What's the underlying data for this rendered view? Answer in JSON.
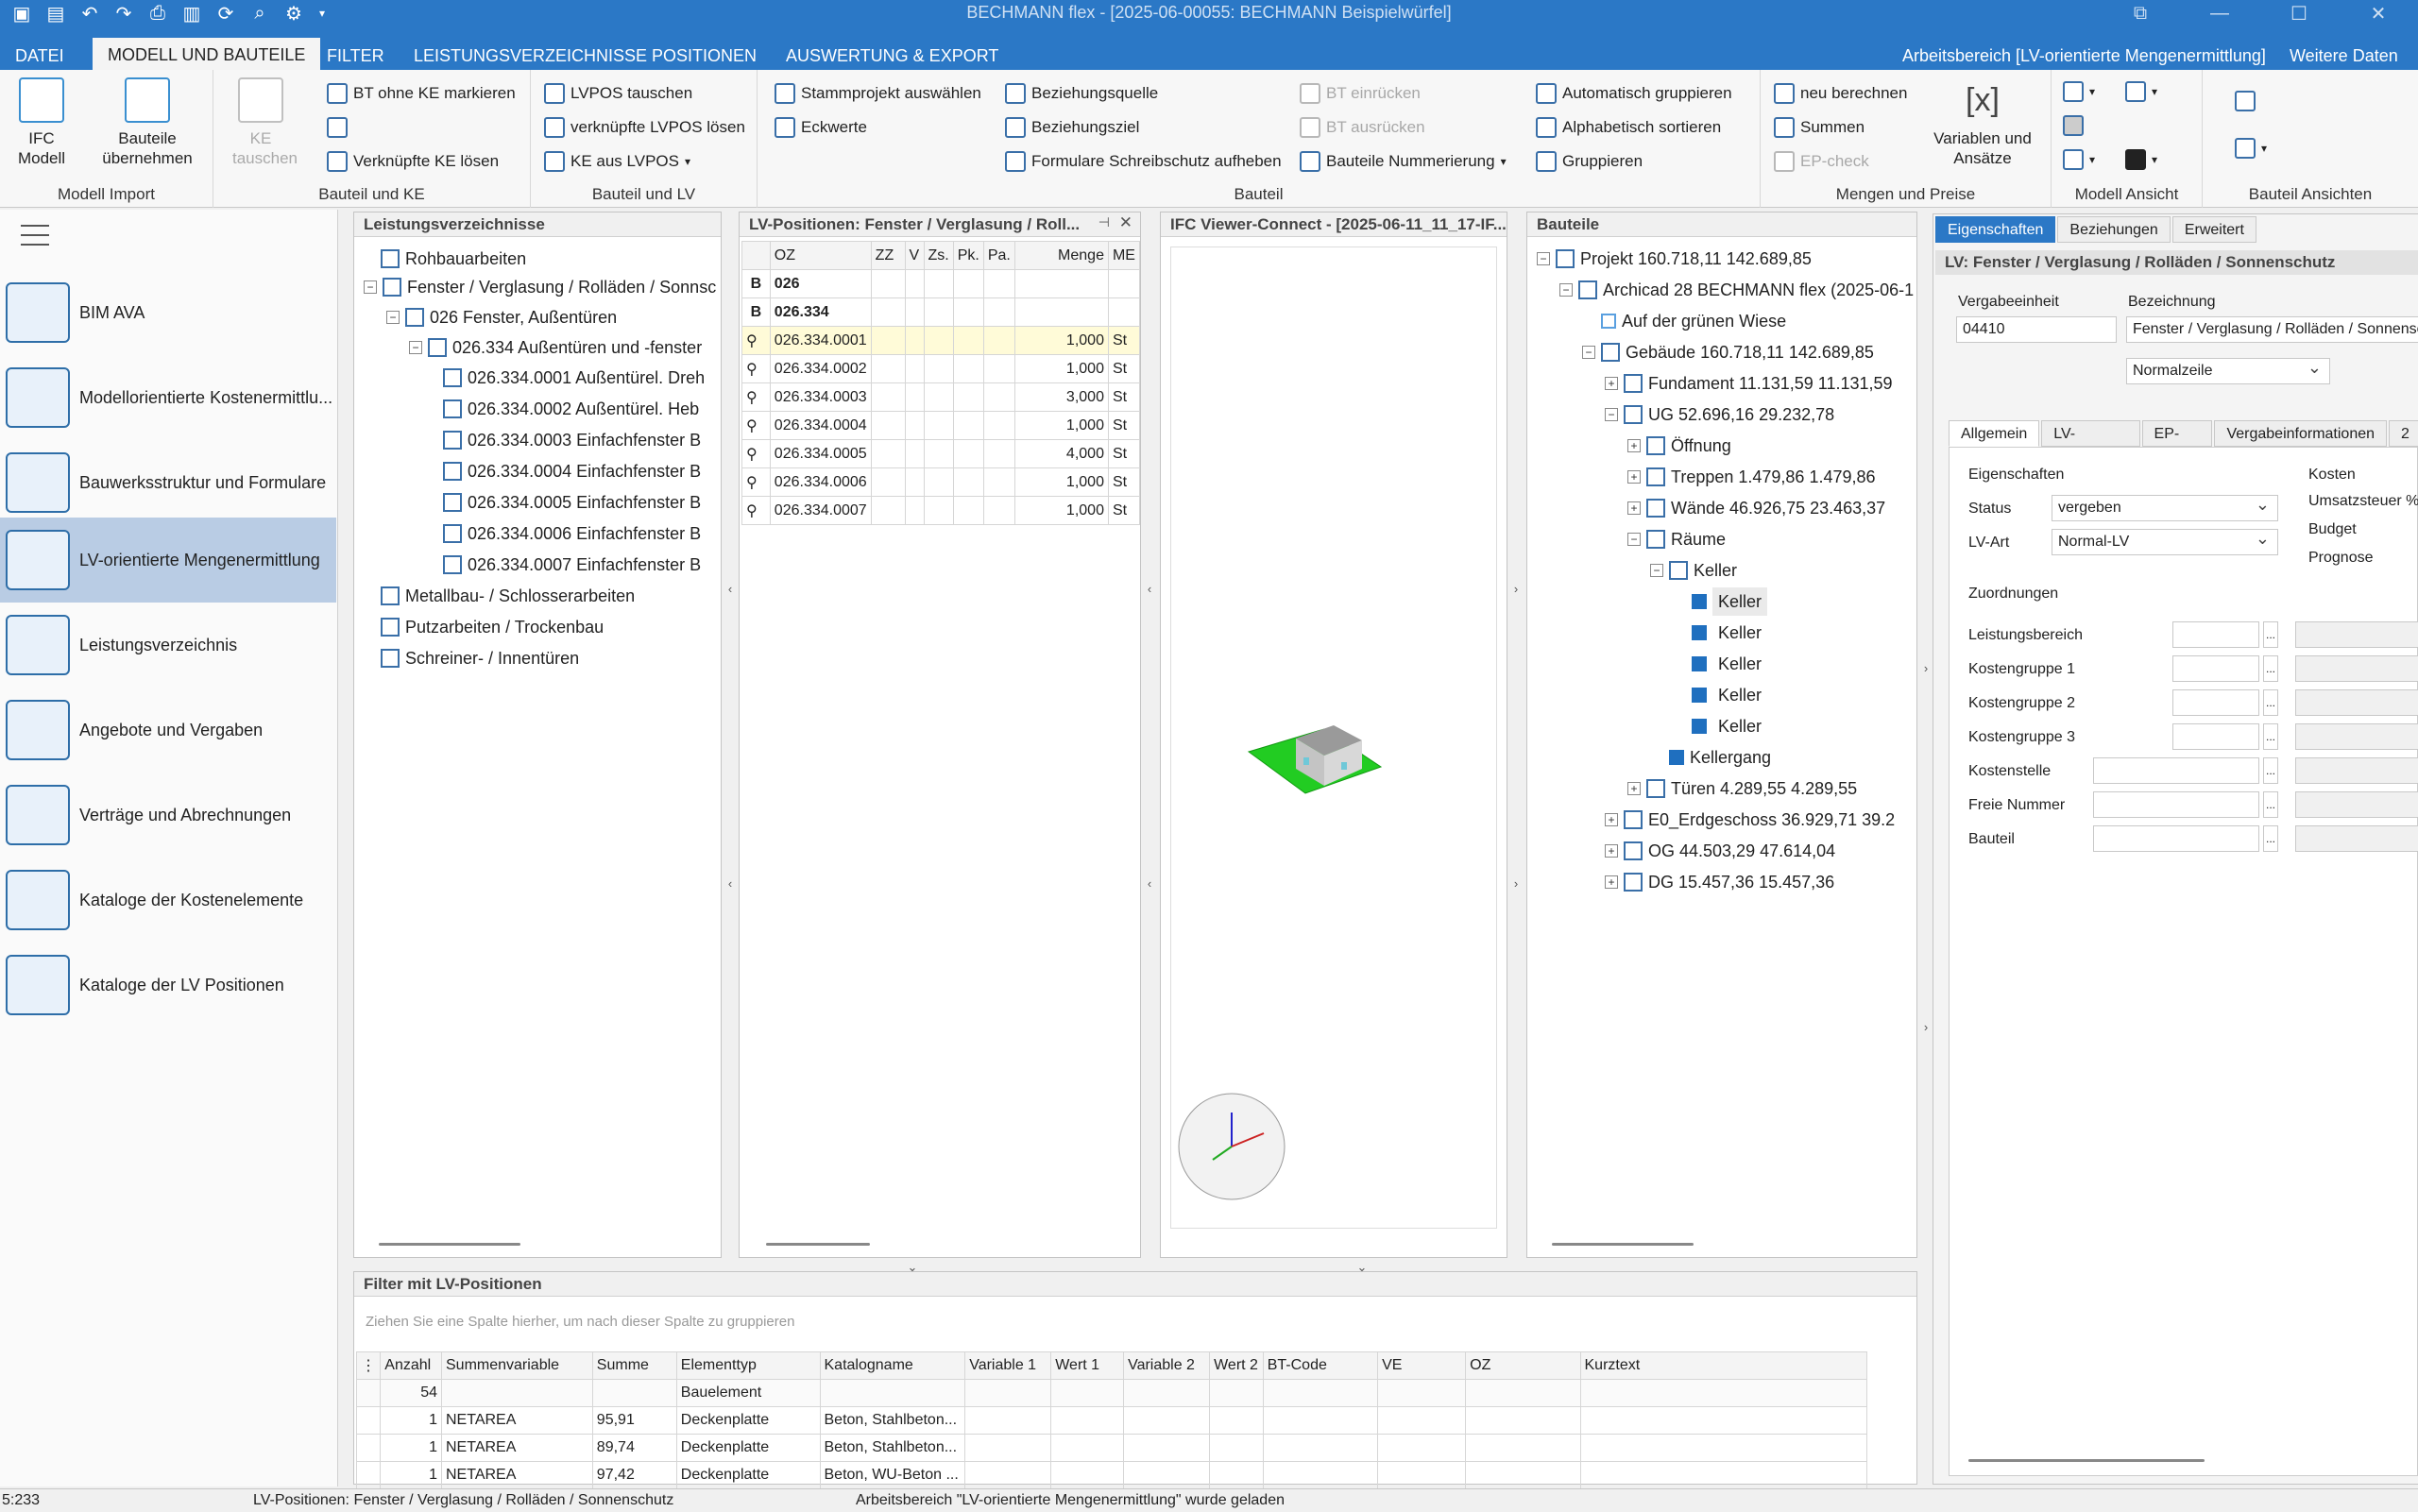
{
  "window": {
    "title": "BECHMANN flex - [2025-06-00055: BECHMANN Beispielwürfel]"
  },
  "menu": {
    "tabs": [
      "DATEI",
      "MODELL UND BAUTEILE",
      "FILTER",
      "LEISTUNGSVERZEICHNISSE",
      "POSITIONEN",
      "AUSWERTUNG & EXPORT"
    ],
    "workspace": "Arbeitsbereich [LV-orientierte Mengenermittlung]",
    "more": "Weitere Daten"
  },
  "ribbon": {
    "g1": {
      "label": "Modell Import",
      "ifc": "IFC\nModell",
      "bauteile": "Bauteile\nübernehmen"
    },
    "g2": {
      "label": "Bauteil und KE",
      "ke_tauschen": "KE\ntauschen",
      "bt_ohne_ke": "BT ohne KE markieren",
      "verknuepfte_ke": "Verknüpfte KE lösen"
    },
    "g3": {
      "label": "Bauteil und LV",
      "lvpos_tauschen": "LVPOS tauschen",
      "verkn_lvpos": "verknüpfte LVPOS lösen",
      "ke_aus_lvpos": "KE aus LVPOS"
    },
    "g4": {
      "label": "Bauteil",
      "stammprojekt": "Stammprojekt auswählen",
      "eckwerte": "Eckwerte",
      "bezquelle": "Beziehungsquelle",
      "bezziel": "Beziehungsziel",
      "formulare": "Formulare Schreibschutz aufheben",
      "bt_einruecken": "BT einrücken",
      "bt_ausruecken": "BT ausrücken",
      "nummerierung": "Bauteile Nummerierung",
      "auto_grupp": "Automatisch gruppieren",
      "alpha": "Alphabetisch sortieren",
      "gruppieren": "Gruppieren"
    },
    "g5": {
      "label": "Mengen und Preise",
      "neu": "neu berechnen",
      "summen": "Summen",
      "epcheck": "EP-check",
      "variablen": "Variablen und\nAnsätze"
    },
    "g6": {
      "label": "Modell Ansicht"
    },
    "g7": {
      "label": "Bauteil Ansichten"
    }
  },
  "nav": {
    "items": [
      "BIM AVA",
      "Modellorientierte Kostenermittlu...",
      "Bauwerksstruktur und Formulare",
      "LV-orientierte Mengenermittlung",
      "Leistungsverzeichnis",
      "Angebote und Vergaben",
      "Verträge und Abrechnungen",
      "Kataloge der Kostenelemente",
      "Kataloge der LV Positionen"
    ]
  },
  "lv": {
    "title": "Leistungsverzeichnisse",
    "rows": [
      "Rohbauarbeiten",
      "Fenster / Verglasung / Rolläden / Sonnsc",
      "026  Fenster, Außentüren",
      "026.334  Außentüren und -fenster",
      "026.334.0001  Außentürel. Dreh",
      "026.334.0002  Außentürel. Heb",
      "026.334.0003  Einfachfenster B",
      "026.334.0004  Einfachfenster B",
      "026.334.0005  Einfachfenster B",
      "026.334.0006  Einfachfenster B",
      "026.334.0007  Einfachfenster B",
      "Metallbau- / Schlosserarbeiten",
      "Putzarbeiten / Trockenbau",
      "Schreiner- / Innentüren"
    ]
  },
  "lvpos": {
    "title": "LV-Positionen: Fenster / Verglasung / Roll...",
    "cols": [
      "OZ",
      "ZZ",
      "V",
      "Zs.",
      "Pk.",
      "Pa.",
      "Menge",
      "ME"
    ],
    "headrows": [
      {
        "t": "B",
        "oz": "026"
      },
      {
        "t": "B",
        "oz": "026.334"
      }
    ],
    "rows": [
      {
        "oz": "026.334.0001",
        "m": "1,000",
        "me": "St"
      },
      {
        "oz": "026.334.0002",
        "m": "1,000",
        "me": "St"
      },
      {
        "oz": "026.334.0003",
        "m": "3,000",
        "me": "St"
      },
      {
        "oz": "026.334.0004",
        "m": "1,000",
        "me": "St"
      },
      {
        "oz": "026.334.0005",
        "m": "4,000",
        "me": "St"
      },
      {
        "oz": "026.334.0006",
        "m": "1,000",
        "me": "St"
      },
      {
        "oz": "026.334.0007",
        "m": "1,000",
        "me": "St"
      }
    ]
  },
  "viewer": {
    "title": "IFC Viewer-Connect - [2025-06-11_11_17-IF..."
  },
  "bauteile": {
    "title": "Bauteile",
    "rows": [
      "Projekt  160.718,11  142.689,85",
      "Archicad 28 BECHMANN flex (2025-06-1",
      "Auf der grünen Wiese",
      "Gebäude  160.718,11  142.689,85",
      "Fundament  11.131,59  11.131,59",
      "UG  52.696,16  29.232,78",
      "Öffnung",
      "Treppen  1.479,86  1.479,86",
      "Wände  46.926,75  23.463,37",
      "Räume",
      "Keller",
      "Keller",
      "Keller",
      "Keller",
      "Keller",
      "Keller",
      "Kellergang",
      "Türen  4.289,55  4.289,55",
      "E0_Erdgeschoss  36.929,71  39.2",
      "OG  44.503,29  47.614,04",
      "DG  15.457,36  15.457,36"
    ]
  },
  "props": {
    "title": "LV: Fenster / Verglasung / Rolläden / Sonnenschutz",
    "tabs": [
      "Eigenschaften",
      "Beziehungen",
      "Erweitert"
    ],
    "vergabe_label": "Vergabeeinheit",
    "vergabe": "04410",
    "bez_label": "Bezeichnung",
    "bez": "Fenster / Verglasung / Rolläden / Sonnenschutz",
    "zeile": "Normalzeile",
    "subtabs": [
      "Allgemein",
      "LV-Gliederung",
      "EP-Anteile",
      "Vergabeinformationen",
      "2"
    ],
    "eig": "Eigenschaften",
    "status_l": "Status",
    "status": "vergeben",
    "lvart_l": "LV-Art",
    "lvart": "Normal-LV",
    "kosten": "Kosten",
    "ust": "Umsatzsteuer %",
    "budget": "Budget",
    "prognose": "Prognose",
    "zuord": "Zuordnungen",
    "fields": [
      "Leistungsbereich",
      "Kostengruppe 1",
      "Kostengruppe 2",
      "Kostengruppe 3",
      "Kostenstelle",
      "Freie Nummer",
      "Bauteil"
    ]
  },
  "filter": {
    "title": "Filter mit LV-Positionen",
    "hint": "Ziehen Sie eine Spalte hierher, um nach dieser Spalte zu gruppieren",
    "cols": [
      "Anzahl",
      "Summenvariable",
      "Summe",
      "Elementtyp",
      "Katalogname",
      "Variable 1",
      "Wert 1",
      "Variable 2",
      "Wert 2",
      "BT-Code",
      "VE",
      "OZ",
      "Kurztext"
    ],
    "rows": [
      [
        "54",
        "",
        "",
        "Bauelement",
        "",
        "",
        "",
        "",
        "",
        "",
        "",
        "",
        ""
      ],
      [
        "1",
        "NETAREA",
        "95,91",
        "Deckenplatte",
        "Beton, Stahlbeton...",
        "",
        "",
        "",
        "",
        "",
        "",
        "",
        ""
      ],
      [
        "1",
        "NETAREA",
        "89,74",
        "Deckenplatte",
        "Beton, Stahlbeton...",
        "",
        "",
        "",
        "",
        "",
        "",
        "",
        ""
      ],
      [
        "1",
        "NETAREA",
        "97,42",
        "Deckenplatte",
        "Beton, WU-Beton ...",
        "",
        "",
        "",
        "",
        "",
        "",
        "",
        ""
      ]
    ]
  },
  "status": {
    "left": "5:233",
    "mid": "LV-Positionen: Fenster / Verglasung / Rolläden / Sonnenschutz",
    "right": "Arbeitsbereich \"LV-orientierte Mengenermittlung\" wurde geladen"
  }
}
